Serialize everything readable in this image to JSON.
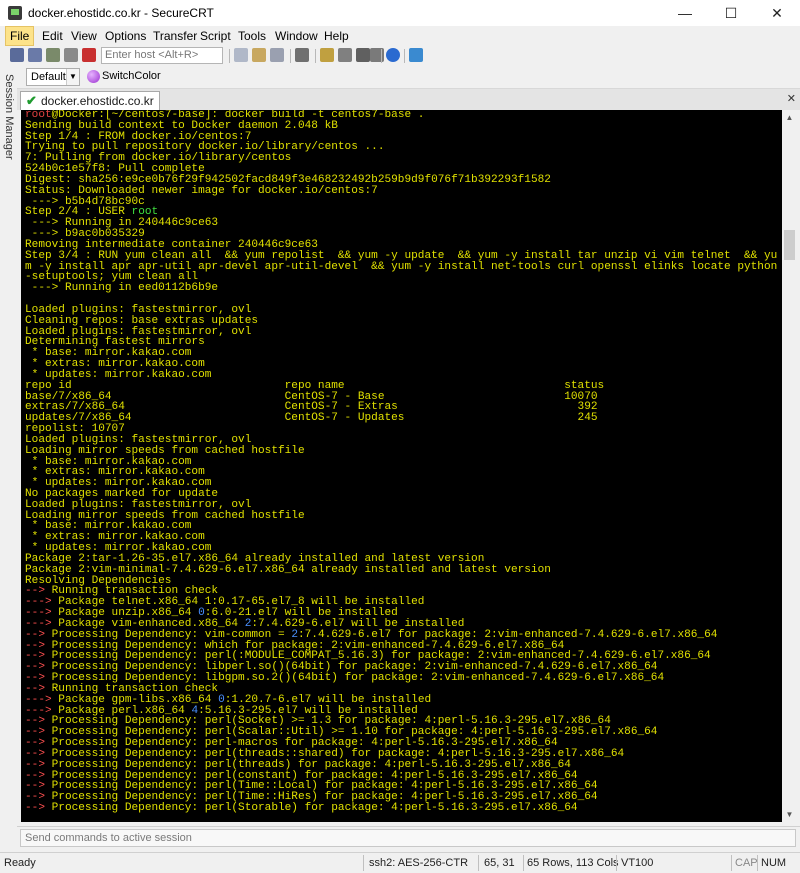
{
  "window": {
    "title": "docker.ehostidc.co.kr - SecureCRT",
    "minimize": "—",
    "maximize": "☐",
    "close": "✕"
  },
  "menu": [
    "File",
    "Edit",
    "View",
    "Options",
    "Transfer",
    "Script",
    "Tools",
    "Window",
    "Help"
  ],
  "toolbar": {
    "host_placeholder": "Enter host <Alt+R>"
  },
  "session_bar": {
    "selected": "Default",
    "switch_color": "SwitchColor"
  },
  "side_panel": {
    "label": "Session Manager"
  },
  "tab": {
    "label": "docker.ehostidc.co.kr",
    "close": "✕"
  },
  "terminal": {
    "lines": [
      {
        "segs": [
          {
            "t": "root",
            "c": "#e04040"
          },
          {
            "t": "@Docker:[~/centos7-base]: docker build -t centos7-base .",
            "c": "#e0e000"
          }
        ]
      },
      {
        "t": "Sending build context to Docker daemon 2.048 kB"
      },
      {
        "t": "Step 1/4 : FROM docker.io/centos:7"
      },
      {
        "t": "Trying to pull repository docker.io/library/centos ..."
      },
      {
        "t": "7: Pulling from docker.io/library/centos"
      },
      {
        "t": "524b0c1e57f8: Pull complete"
      },
      {
        "t": "Digest: sha256:e9ce0b76f29f942502facd849f3e468232492b259b9d9f076f71b392293f1582"
      },
      {
        "t": "Status: Downloaded newer image for docker.io/centos:7"
      },
      {
        "t": " ---> b5b4d78bc90c"
      },
      {
        "segs": [
          {
            "t": "Step 2/4 : USER ",
            "c": "#e0e000"
          },
          {
            "t": "root",
            "c": "#40e040"
          }
        ]
      },
      {
        "t": " ---> Running in 240446c9ce63"
      },
      {
        "t": " ---> b9ac0b035329"
      },
      {
        "t": "Removing intermediate container 240446c9ce63"
      },
      {
        "t": "Step 3/4 : RUN yum clean all  && yum repolist  && yum -y update  && yum -y install tar unzip vi vim telnet  && yu"
      },
      {
        "t": "m -y install apr apr-util apr-devel apr-util-devel  && yum -y install net-tools curl openssl elinks locate python"
      },
      {
        "t": "-setuptools; yum clean all"
      },
      {
        "t": " ---> Running in eed0112b6b9e"
      },
      {
        "t": ""
      },
      {
        "t": "Loaded plugins: fastestmirror, ovl"
      },
      {
        "t": "Cleaning repos: base extras updates"
      },
      {
        "t": "Loaded plugins: fastestmirror, ovl"
      },
      {
        "t": "Determining fastest mirrors"
      },
      {
        "t": " * base: mirror.kakao.com"
      },
      {
        "t": " * extras: mirror.kakao.com"
      },
      {
        "t": " * updates: mirror.kakao.com"
      },
      {
        "t": "repo id                                repo name                                 status"
      },
      {
        "t": "base/7/x86_64                          CentOS-7 - Base                           10070"
      },
      {
        "t": "extras/7/x86_64                        CentOS-7 - Extras                           392"
      },
      {
        "t": "updates/7/x86_64                       CentOS-7 - Updates                          245"
      },
      {
        "t": "repolist: 10707"
      },
      {
        "t": "Loaded plugins: fastestmirror, ovl"
      },
      {
        "t": "Loading mirror speeds from cached hostfile"
      },
      {
        "t": " * base: mirror.kakao.com"
      },
      {
        "t": " * extras: mirror.kakao.com"
      },
      {
        "t": " * updates: mirror.kakao.com"
      },
      {
        "t": "No packages marked for update"
      },
      {
        "t": "Loaded plugins: fastestmirror, ovl"
      },
      {
        "t": "Loading mirror speeds from cached hostfile"
      },
      {
        "t": " * base: mirror.kakao.com"
      },
      {
        "t": " * extras: mirror.kakao.com"
      },
      {
        "t": " * updates: mirror.kakao.com"
      },
      {
        "t": "Package 2:tar-1.26-35.el7.x86_64 already installed and latest version"
      },
      {
        "t": "Package 2:vim-minimal-7.4.629-6.el7.x86_64 already installed and latest version"
      },
      {
        "t": "Resolving Dependencies"
      },
      {
        "segs": [
          {
            "t": "-->",
            "c": "#ff5050"
          },
          {
            "t": " Running transaction check",
            "c": "#e0e000"
          }
        ]
      },
      {
        "segs": [
          {
            "t": "--->",
            "c": "#ff5050"
          },
          {
            "t": " Package telnet.x86_64 1:0.17-65.el7_8 will be installed",
            "c": "#e0e000"
          }
        ]
      },
      {
        "segs": [
          {
            "t": "--->",
            "c": "#ff5050"
          },
          {
            "t": " Package unzip.x86_64 ",
            "c": "#e0e000"
          },
          {
            "t": "0",
            "c": "#4a90ff"
          },
          {
            "t": ":6.0-21.el7 will be installed",
            "c": "#e0e000"
          }
        ]
      },
      {
        "segs": [
          {
            "t": "--->",
            "c": "#ff5050"
          },
          {
            "t": " Package vim-enhanced.x86_64 ",
            "c": "#e0e000"
          },
          {
            "t": "2",
            "c": "#4a90ff"
          },
          {
            "t": ":7.4.629-6.el7 will be installed",
            "c": "#e0e000"
          }
        ]
      },
      {
        "segs": [
          {
            "t": "-->",
            "c": "#ff5050"
          },
          {
            "t": " Processing Dependency: vim-common = ",
            "c": "#e0e000"
          },
          {
            "t": "2",
            "c": "#4a90ff"
          },
          {
            "t": ":7.4.629-6.el7 for package: 2:vim-enhanced-7.4.629-6.el7.x86_64",
            "c": "#e0e000"
          }
        ]
      },
      {
        "segs": [
          {
            "t": "-->",
            "c": "#ff5050"
          },
          {
            "t": " Processing Dependency: which for package: 2:vim-enhanced-7.4.629-6.el7.x86_64",
            "c": "#e0e000"
          }
        ]
      },
      {
        "segs": [
          {
            "t": "-->",
            "c": "#ff5050"
          },
          {
            "t": " Processing Dependency: perl(:MODULE_COMPAT_5.16.3) for package: 2:vim-enhanced-7.4.629-6.el7.x86_64",
            "c": "#e0e000"
          }
        ]
      },
      {
        "segs": [
          {
            "t": "-->",
            "c": "#ff5050"
          },
          {
            "t": " Processing Dependency: libperl.so()(64bit) for package: 2:vim-enhanced-7.4.629-6.el7.x86_64",
            "c": "#e0e000"
          }
        ]
      },
      {
        "segs": [
          {
            "t": "-->",
            "c": "#ff5050"
          },
          {
            "t": " Processing Dependency: libgpm.so.2()(64bit) for package: 2:vim-enhanced-7.4.629-6.el7.x86_64",
            "c": "#e0e000"
          }
        ]
      },
      {
        "segs": [
          {
            "t": "-->",
            "c": "#ff5050"
          },
          {
            "t": " Running transaction check",
            "c": "#e0e000"
          }
        ]
      },
      {
        "segs": [
          {
            "t": "--->",
            "c": "#ff5050"
          },
          {
            "t": " Package gpm-libs.x86_64 ",
            "c": "#e0e000"
          },
          {
            "t": "0",
            "c": "#4a90ff"
          },
          {
            "t": ":1.20.7-6.el7 will be installed",
            "c": "#e0e000"
          }
        ]
      },
      {
        "segs": [
          {
            "t": "--->",
            "c": "#ff5050"
          },
          {
            "t": " Package perl.x86_64 ",
            "c": "#e0e000"
          },
          {
            "t": "4",
            "c": "#4a90ff"
          },
          {
            "t": ":5.16.3-295.el7 will be installed",
            "c": "#e0e000"
          }
        ]
      },
      {
        "segs": [
          {
            "t": "-->",
            "c": "#ff5050"
          },
          {
            "t": " Processing Dependency: perl(Socket) >= 1.3 for package: 4:perl-5.16.3-295.el7.x86_64",
            "c": "#e0e000"
          }
        ]
      },
      {
        "segs": [
          {
            "t": "-->",
            "c": "#ff5050"
          },
          {
            "t": " Processing Dependency: perl(Scalar::Util) >= 1.10 for package: 4:perl-5.16.3-295.el7.x86_64",
            "c": "#e0e000"
          }
        ]
      },
      {
        "segs": [
          {
            "t": "-->",
            "c": "#ff5050"
          },
          {
            "t": " Processing Dependency: perl-macros for package: 4:perl-5.16.3-295.el7.x86_64",
            "c": "#e0e000"
          }
        ]
      },
      {
        "segs": [
          {
            "t": "-->",
            "c": "#ff5050"
          },
          {
            "t": " Processing Dependency: perl(threads::shared) for package: 4:perl-5.16.3-295.el7.x86_64",
            "c": "#e0e000"
          }
        ]
      },
      {
        "segs": [
          {
            "t": "-->",
            "c": "#ff5050"
          },
          {
            "t": " Processing Dependency: perl(threads) for package: 4:perl-5.16.3-295.el7.x86_64",
            "c": "#e0e000"
          }
        ]
      },
      {
        "segs": [
          {
            "t": "-->",
            "c": "#ff5050"
          },
          {
            "t": " Processing Dependency: perl(constant) for package: 4:perl-5.16.3-295.el7.x86_64",
            "c": "#e0e000"
          }
        ]
      },
      {
        "segs": [
          {
            "t": "-->",
            "c": "#ff5050"
          },
          {
            "t": " Processing Dependency: perl(Time::Local) for package: 4:perl-5.16.3-295.el7.x86_64",
            "c": "#e0e000"
          }
        ]
      },
      {
        "segs": [
          {
            "t": "-->",
            "c": "#ff5050"
          },
          {
            "t": " Processing Dependency: perl(Time::HiRes) for package: 4:perl-5.16.3-295.el7.x86_64",
            "c": "#e0e000"
          }
        ]
      },
      {
        "segs": [
          {
            "t": "-->",
            "c": "#ff5050"
          },
          {
            "t": " Processing Dependency: perl(Storable) for package: 4:perl-5.16.3-295.el7.x86_64",
            "c": "#e0e000"
          }
        ]
      }
    ]
  },
  "command_bar": {
    "placeholder": "Send commands to active session"
  },
  "status": {
    "ready": "Ready",
    "cipher": "ssh2: AES-256-CTR",
    "cursor": "65,  31",
    "size": "65 Rows, 113 Cols",
    "emulation": "VT100",
    "cap": "CAP",
    "num": "NUM"
  },
  "colors": {
    "terminal_bg": "#000000",
    "terminal_fg": "#e0e000",
    "prompt_user": "#e04040",
    "arrow": "#ff5050",
    "epoch": "#4a90ff",
    "root_keyword": "#40e040"
  }
}
